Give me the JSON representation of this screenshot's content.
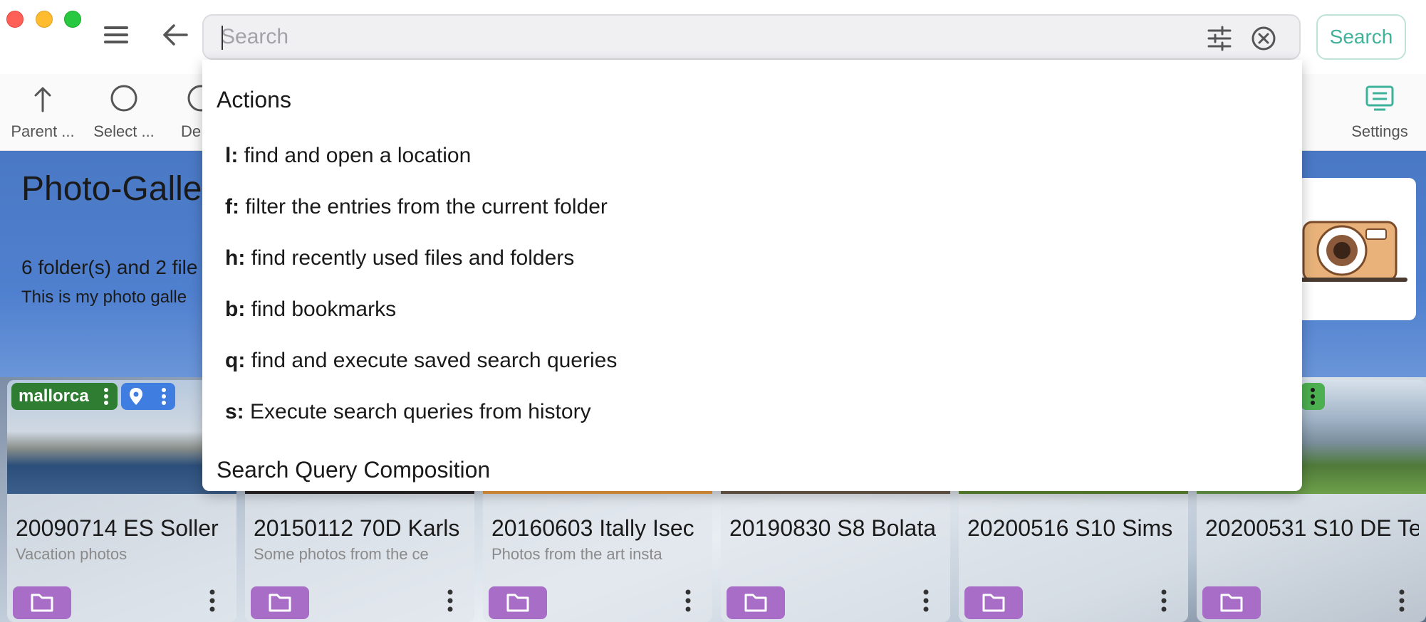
{
  "search": {
    "placeholder": "Search",
    "button_label": "Search"
  },
  "toolbar": {
    "items": [
      {
        "label": "Parent ...",
        "icon": "arrow-up-icon"
      },
      {
        "label": "Select ...",
        "icon": "circle-icon"
      },
      {
        "label": "De",
        "icon": "circle-icon"
      },
      {
        "label": "Settings",
        "icon": "settings-monitor-icon"
      }
    ]
  },
  "main": {
    "title": "Photo-Galler",
    "summary": "6 folder(s) and 2 file",
    "description": "This is my photo galle"
  },
  "dropdown": {
    "actions_header": "Actions",
    "items": [
      {
        "key": "l:",
        "text": "find and open a location"
      },
      {
        "key": "f:",
        "text": "filter the entries from the current folder"
      },
      {
        "key": "h:",
        "text": "find recently used files and folders"
      },
      {
        "key": "b:",
        "text": "find bookmarks"
      },
      {
        "key": "q:",
        "text": "find and execute saved search queries"
      },
      {
        "key": "s:",
        "text": "Execute search queries from history"
      }
    ],
    "composition_header": "Search Query Composition"
  },
  "tags": {
    "first_tag": "mallorca"
  },
  "folders": [
    {
      "name": "20090714 ES Soller",
      "description": "Vacation photos"
    },
    {
      "name": "20150112 70D Karls",
      "description": "Some photos from the ce"
    },
    {
      "name": "20160603 Itally Isec",
      "description": "Photos from the art insta"
    },
    {
      "name": "20190830 S8 Bolata",
      "description": ""
    },
    {
      "name": "20200516 S10 Sims",
      "description": ""
    },
    {
      "name": "20200531 S10 DE Te",
      "description": ""
    }
  ],
  "colors": {
    "accent": "#3fb39a",
    "folder_button": "#a86dc6",
    "tag_green": "#2e7d32",
    "tag_blue": "#3f7de0"
  }
}
